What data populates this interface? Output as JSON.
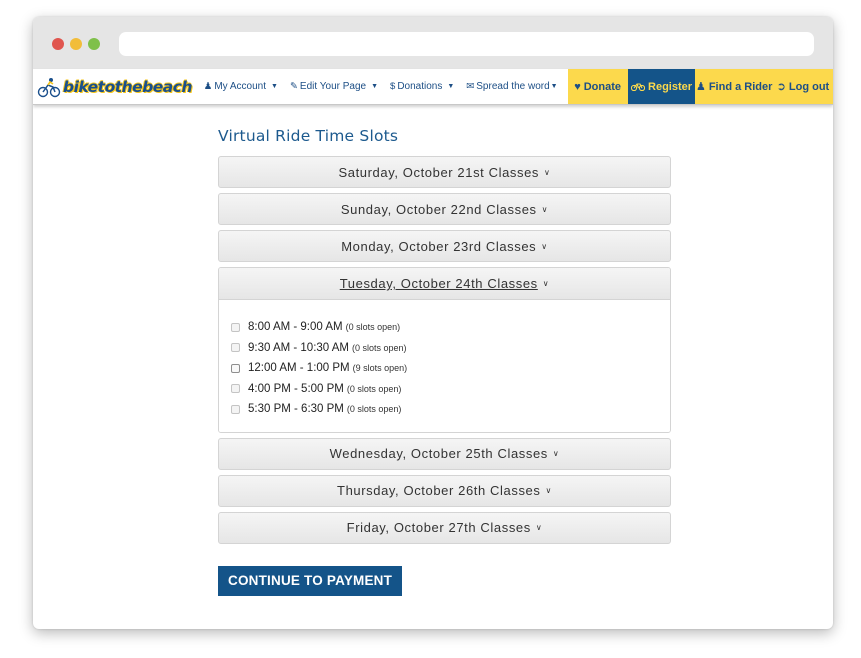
{
  "nav": {
    "logo_text": "biketothebeach",
    "my_account": "My Account",
    "edit_page": "Edit Your Page",
    "donations": "Donations",
    "spread_word": "Spread the word",
    "donate": "Donate",
    "register": "Register",
    "find_rider": "Find a Rider",
    "log_out": "Log out",
    "icons": {
      "my_account": "user-icon",
      "edit_page": "edit-icon",
      "donations": "dollar-icon",
      "spread_word": "envelope-icon",
      "donate": "heart-icon",
      "register": "bicycle-icon",
      "find_rider": "user-icon",
      "log_out": "sign-out-icon"
    },
    "colors": {
      "yellow": "#fcd94c",
      "blue": "#145489"
    }
  },
  "page": {
    "title": "Virtual Ride Time Slots",
    "days": [
      "Saturday, October 21st Classes",
      "Sunday, October 22nd Classes",
      "Monday, October 23rd Classes",
      "Tuesday, October 24th Classes",
      "Wednesday, October 25th Classes",
      "Thursday, October 26th Classes",
      "Friday, October 27th Classes"
    ],
    "expanded_day": "Tuesday, October 24th Classes",
    "slots": [
      {
        "time": "8:00 AM - 9:00 AM",
        "open": "(0 slots open)",
        "checked": false,
        "enabled": false
      },
      {
        "time": "9:30 AM - 10:30 AM",
        "open": "(0 slots open)",
        "checked": false,
        "enabled": false
      },
      {
        "time": "12:00 AM - 1:00 PM",
        "open": "(9 slots open)",
        "checked": false,
        "enabled": true
      },
      {
        "time": "4:00 PM - 5:00 PM",
        "open": "(0 slots open)",
        "checked": false,
        "enabled": false
      },
      {
        "time": "5:30 PM - 6:30 PM",
        "open": "(0 slots open)",
        "checked": false,
        "enabled": false
      }
    ],
    "continue_label": "CONTINUE TO PAYMENT"
  }
}
